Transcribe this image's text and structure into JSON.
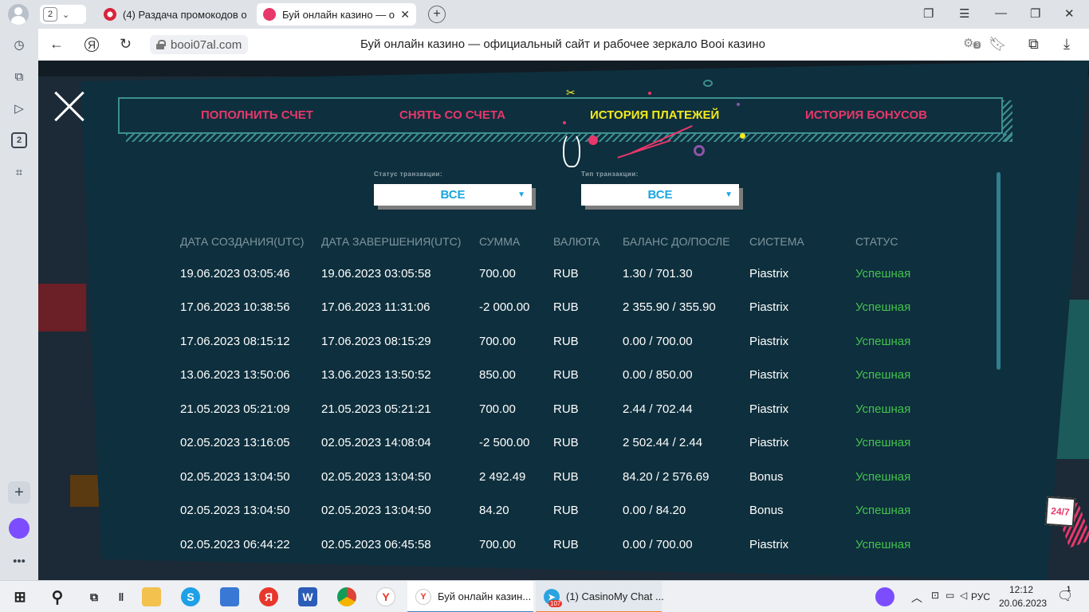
{
  "browser": {
    "tab_counter": "2",
    "tabs": [
      {
        "title": "(4) Раздача промокодов о",
        "active": false
      },
      {
        "title": "Буй онлайн казино — о",
        "active": true
      }
    ],
    "url": "booi07al.com",
    "page_title": "Буй онлайн казино — официальный сайт и рабочее зеркало Booi казино",
    "ext_badge": "3",
    "rail_badge": "2"
  },
  "modal": {
    "tabs": [
      {
        "label": "ПОПОЛНИТЬ СЧЕТ",
        "active": false
      },
      {
        "label": "СНЯТЬ СО СЧЕТА",
        "active": false
      },
      {
        "label": "ИСТОРИЯ ПЛАТЕЖЕЙ",
        "active": true
      },
      {
        "label": "ИСТОРИЯ БОНУСОВ",
        "active": false
      }
    ],
    "filters": [
      {
        "label": "Статус транзакции:",
        "value": "ВСЕ"
      },
      {
        "label": "Тип транзакции:",
        "value": "ВСЕ"
      }
    ],
    "table": {
      "headers": [
        "ДАТА СОЗДАНИЯ(UTC)",
        "ДАТА ЗАВЕРШЕНИЯ(UTC)",
        "СУММА",
        "ВАЛЮТА",
        "БАЛАНС ДО/ПОСЛЕ",
        "СИСТЕМА",
        "СТАТУС"
      ],
      "rows": [
        [
          "19.06.2023 03:05:46",
          "19.06.2023 03:05:58",
          "700.00",
          "RUB",
          "1.30 / 701.30",
          "Piastrix",
          "Успешная"
        ],
        [
          "17.06.2023 10:38:56",
          "17.06.2023 11:31:06",
          "-2 000.00",
          "RUB",
          "2 355.90 / 355.90",
          "Piastrix",
          "Успешная"
        ],
        [
          "17.06.2023 08:15:12",
          "17.06.2023 08:15:29",
          "700.00",
          "RUB",
          "0.00 / 700.00",
          "Piastrix",
          "Успешная"
        ],
        [
          "13.06.2023 13:50:06",
          "13.06.2023 13:50:52",
          "850.00",
          "RUB",
          "0.00 / 850.00",
          "Piastrix",
          "Успешная"
        ],
        [
          "21.05.2023 05:21:09",
          "21.05.2023 05:21:21",
          "700.00",
          "RUB",
          "2.44 / 702.44",
          "Piastrix",
          "Успешная"
        ],
        [
          "02.05.2023 13:16:05",
          "02.05.2023 14:08:04",
          "-2 500.00",
          "RUB",
          "2 502.44 / 2.44",
          "Piastrix",
          "Успешная"
        ],
        [
          "02.05.2023 13:04:50",
          "02.05.2023 13:04:50",
          "2 492.49",
          "RUB",
          "84.20 / 2 576.69",
          "Bonus",
          "Успешная"
        ],
        [
          "02.05.2023 13:04:50",
          "02.05.2023 13:04:50",
          "84.20",
          "RUB",
          "0.00 / 84.20",
          "Bonus",
          "Успешная"
        ],
        [
          "02.05.2023 06:44:22",
          "02.05.2023 06:45:58",
          "700.00",
          "RUB",
          "0.00 / 700.00",
          "Piastrix",
          "Успешная"
        ]
      ]
    },
    "support_label": "24/7"
  },
  "taskbar": {
    "apps": [
      {
        "title": "Буй онлайн казин...",
        "active": true
      },
      {
        "title": "(1) CasinoMy Chat ...",
        "active": false,
        "badge": "107"
      }
    ],
    "lang": "РУС",
    "time": "12:12",
    "date": "20.06.2023",
    "notif_count": "1"
  },
  "colors": {
    "modal_bg": "#0e2f3d",
    "tab_pink": "#e8376b",
    "tab_active": "#f3ea1c",
    "status_green": "#43c24e",
    "select_blue": "#1aa6df"
  }
}
